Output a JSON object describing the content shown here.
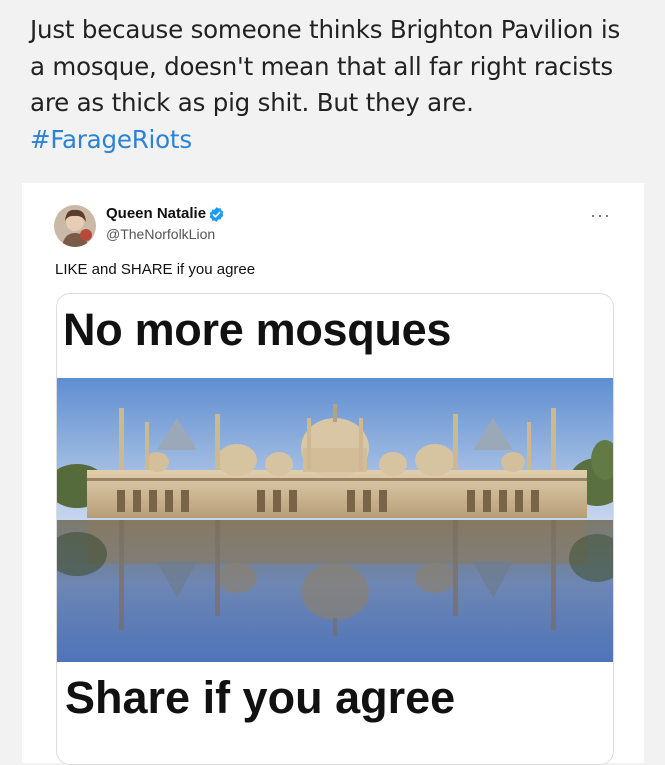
{
  "post": {
    "line1": "Just because someone thinks Brighton Pavilion is",
    "line2": "a mosque, doesn't mean that all far right racists",
    "line3": "are as thick as pig shit. But they are.",
    "hashtag": "#FarageRiots"
  },
  "embedded_tweet": {
    "author_name": "Queen Natalie",
    "author_handle": "@TheNorfolkLion",
    "more_icon": "···",
    "text": "LIKE and SHARE if you agree",
    "image": {
      "headline_top": "No more mosques",
      "headline_bottom": "Share if you agree"
    }
  },
  "icons": [
    "verified-badge-icon",
    "more-options-icon"
  ],
  "colors": {
    "hashtag": "#2b82d6",
    "verified": "#1d9bf0",
    "page_background": "#f2f2f2"
  }
}
